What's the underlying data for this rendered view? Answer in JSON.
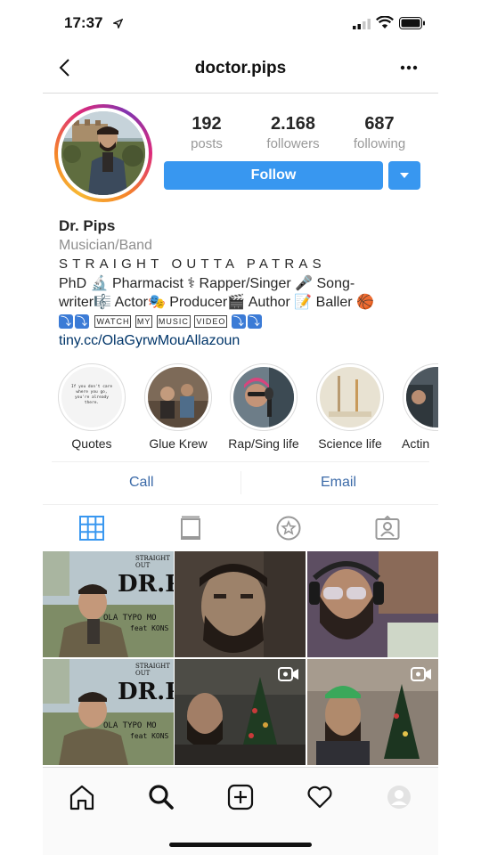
{
  "status_bar": {
    "time": "17:37"
  },
  "header": {
    "title": "doctor.pips"
  },
  "profile": {
    "stats": [
      {
        "value": "192",
        "label": "posts"
      },
      {
        "value": "2.168",
        "label": "followers"
      },
      {
        "value": "687",
        "label": "following"
      }
    ],
    "follow_label": "Follow"
  },
  "bio": {
    "name": "Dr. Pips",
    "category": "Musician/Band",
    "tagline": "STRAIGHT OUTTA PATRAS",
    "line1": "PhD 🔬 Pharmacist ⚕ Rapper/Singer 🎤 Song-",
    "line2": "writer🎼 Actor🎭 Producer🎬 Author 📝 Baller 🏀",
    "line3_words": [
      "WATCH",
      "MY",
      "MUSIC",
      "VIDEO"
    ],
    "link": "tiny.cc/OlaGyrwMouAllazoun"
  },
  "highlights": [
    {
      "label": "Quotes",
      "quote_text": "If you don't care where you go, you're already there."
    },
    {
      "label": "Glue Krew"
    },
    {
      "label": "Rap/Sing life"
    },
    {
      "label": "Science life"
    },
    {
      "label": "Actin"
    }
  ],
  "actions": {
    "call": "Call",
    "email": "Email"
  },
  "grid": {
    "poster_title": "DR.P",
    "poster_banner": "STRAIGHT OUT",
    "poster_sub1": "OLA TYPO MO",
    "poster_sub2": "feat KONS"
  },
  "colors": {
    "accent": "#3897f0",
    "link": "#003569",
    "muted": "#8e8e8e"
  }
}
